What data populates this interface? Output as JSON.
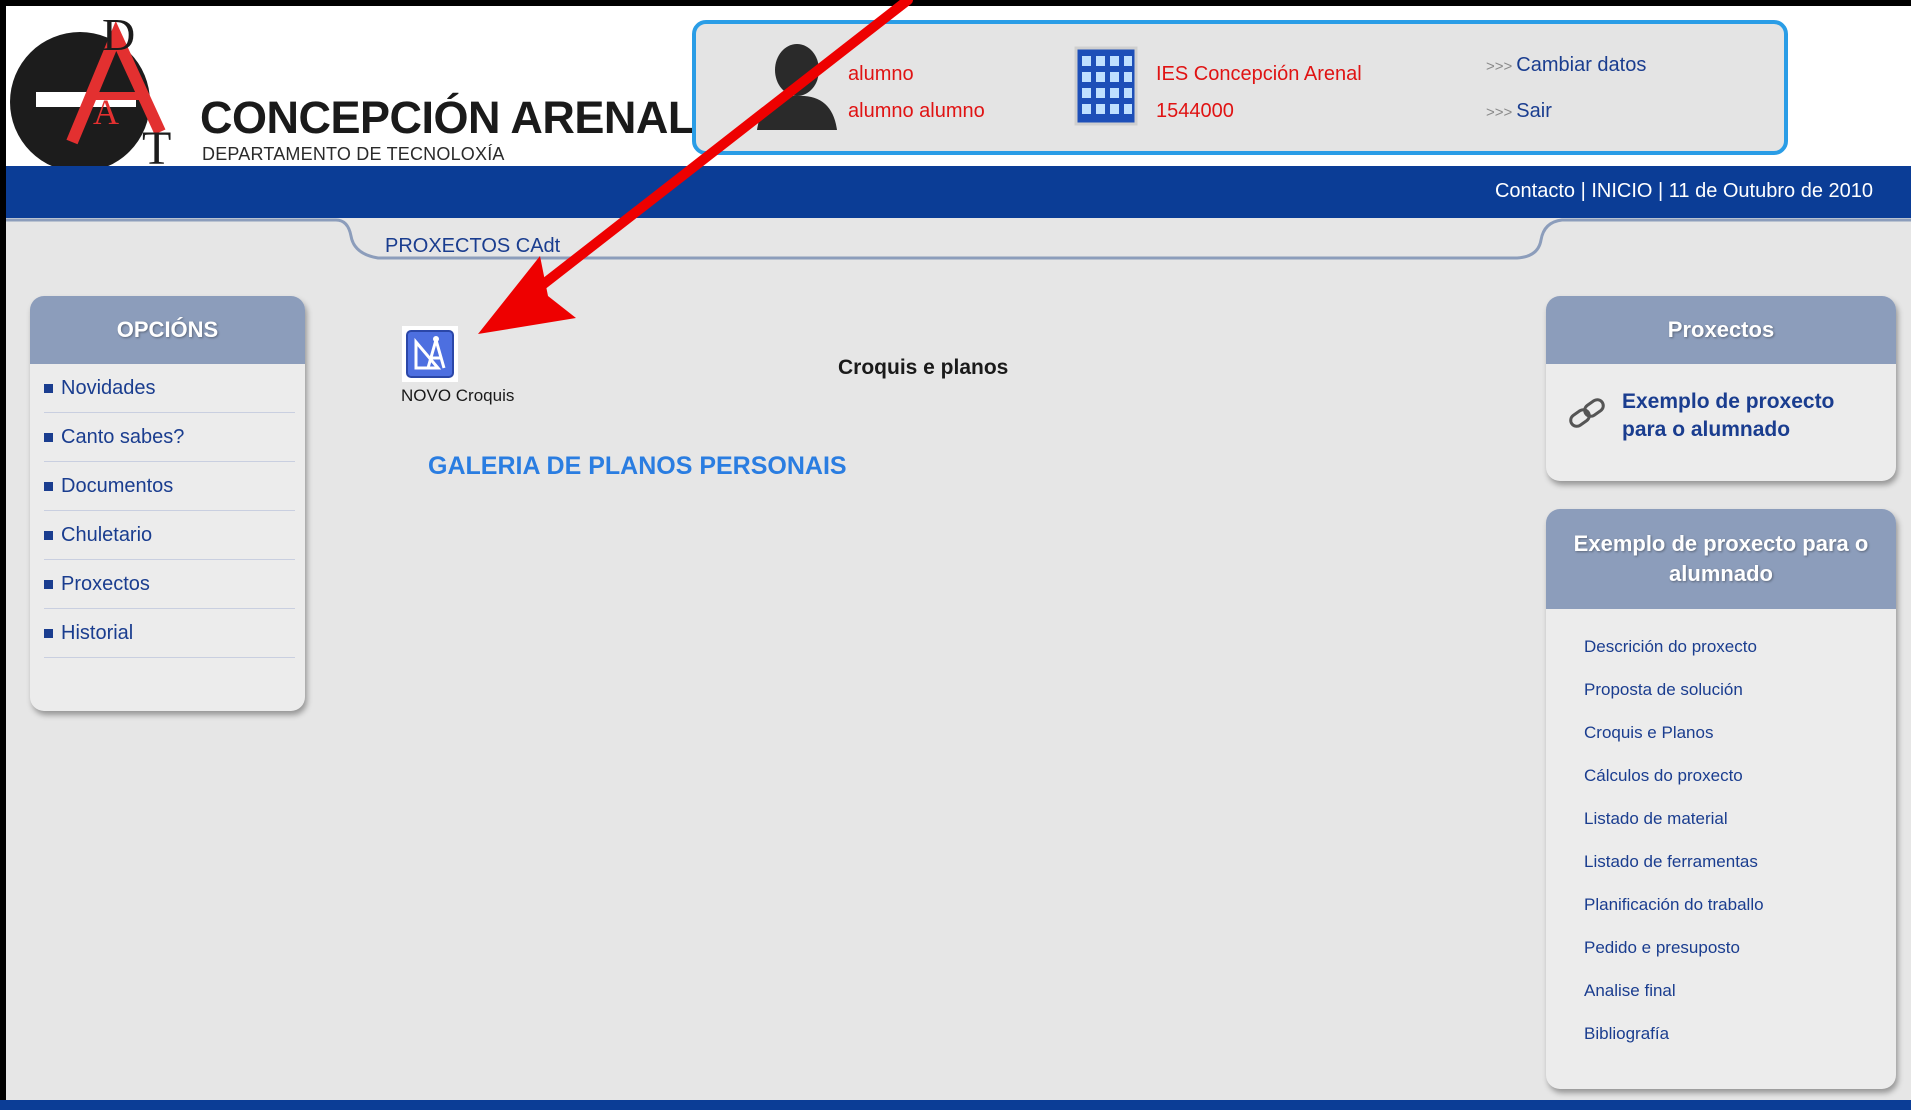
{
  "header": {
    "logo_letters": [
      "D",
      "A",
      "T"
    ],
    "school_name": "CONCEPCIÓN ARENAL",
    "department": "DEPARTAMENTO DE TECNOLOXÍA"
  },
  "user_panel": {
    "user_login": "alumno",
    "user_fullname": "alumno alumno",
    "school": "IES Concepción Arenal",
    "school_code": "1544000",
    "links": {
      "change_data": "Cambiar datos",
      "exit": "Sair"
    },
    "link_prefix": ">>>"
  },
  "top_bar": {
    "text": "Contacto | INICIO | 11 de Outubro de 2010"
  },
  "tab": {
    "label": "PROXECTOS CAdt"
  },
  "sidebar": {
    "title": "OPCIÓNS",
    "items": [
      {
        "label": "Novidades"
      },
      {
        "label": "Canto sabes?"
      },
      {
        "label": "Documentos"
      },
      {
        "label": "Chuletario"
      },
      {
        "label": "Proxectos"
      },
      {
        "label": "Historial"
      }
    ]
  },
  "main": {
    "new_label": "NOVO Croquis",
    "title": "Croquis e planos",
    "gallery_link": "GALERIA DE PLANOS PERSONAIS"
  },
  "right_panel": {
    "proxectos_title": "Proxectos",
    "project_link": "Exemplo de proxecto para o alumnado",
    "example_title": "Exemplo de proxecto para o alumnado",
    "sections": [
      {
        "label": "Descrición do proxecto"
      },
      {
        "label": "Proposta de solución"
      },
      {
        "label": "Croquis e Planos"
      },
      {
        "label": "Cálculos do proxecto"
      },
      {
        "label": "Listado de material"
      },
      {
        "label": "Listado de ferramentas"
      },
      {
        "label": "Planificación do traballo"
      },
      {
        "label": "Pedido e presuposto"
      },
      {
        "label": "Analise final"
      },
      {
        "label": "Bibliografía"
      }
    ]
  },
  "colors": {
    "accent_blue": "#0b3d96",
    "link_blue": "#1a3d8f",
    "gallery_blue": "#2a7de1",
    "panel_border": "#2a9de6",
    "user_red": "#e01313",
    "box_header": "#8c9dbb",
    "annotation_arrow": "#ee0000"
  },
  "icons": [
    "user-avatar-icon",
    "school-building-icon",
    "novo-croquis-icon",
    "link-chain-icon"
  ]
}
